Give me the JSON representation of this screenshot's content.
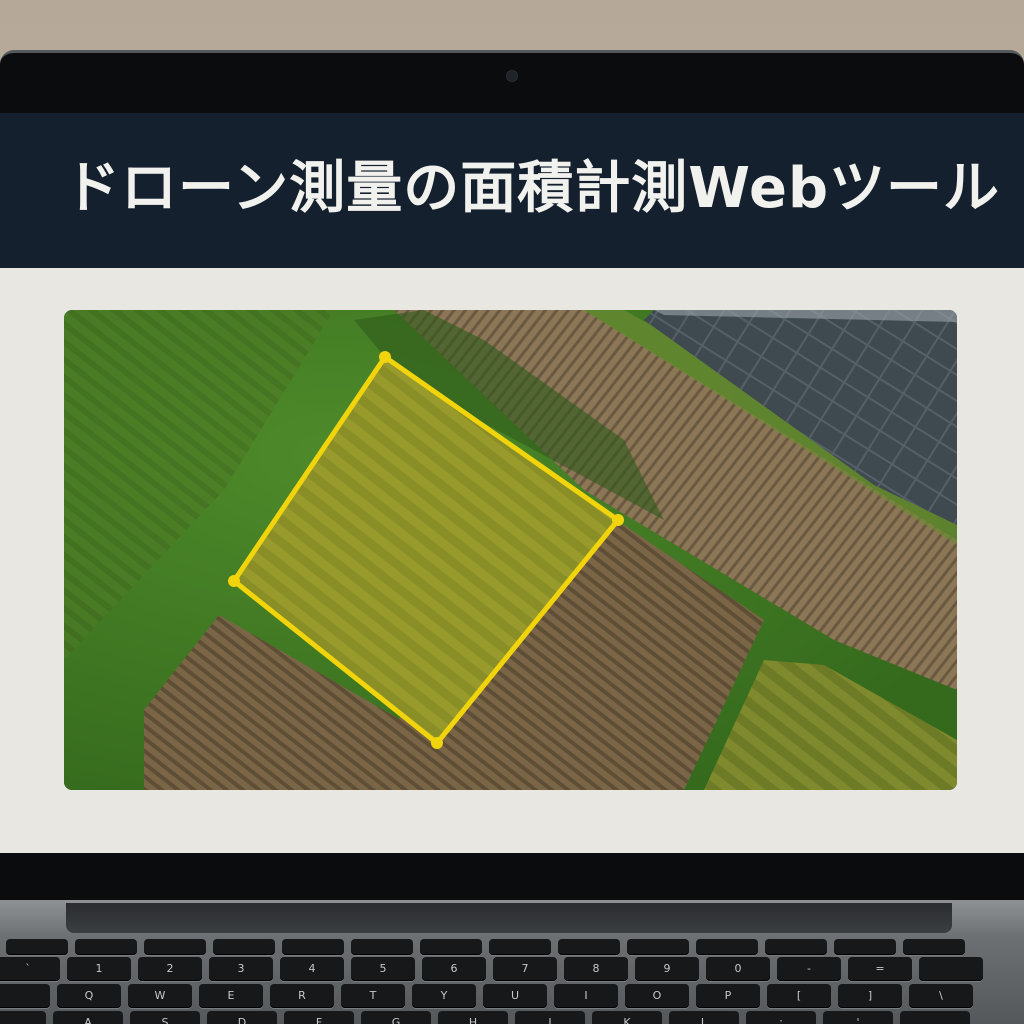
{
  "app": {
    "title": "ドローン測量の面積計測Webツール"
  },
  "measurement": {
    "polygon_color": "#f2d40c",
    "fill_color": "rgba(240, 215, 40, 0.22)"
  },
  "keyboard": {
    "row1": [
      "",
      "",
      "",
      "",
      "",
      "",
      "",
      "",
      "",
      "",
      "",
      "",
      "",
      ""
    ],
    "row2": [
      "`",
      "1",
      "2",
      "3",
      "4",
      "5",
      "6",
      "7",
      "8",
      "9",
      "0",
      "-",
      "=",
      ""
    ],
    "row3": [
      "",
      "Q",
      "W",
      "E",
      "R",
      "T",
      "Y",
      "U",
      "I",
      "O",
      "P",
      "[",
      "]",
      "\\"
    ],
    "row4": [
      "",
      "A",
      "S",
      "D",
      "F",
      "G",
      "H",
      "J",
      "K",
      "L",
      ";",
      "'",
      ""
    ]
  }
}
